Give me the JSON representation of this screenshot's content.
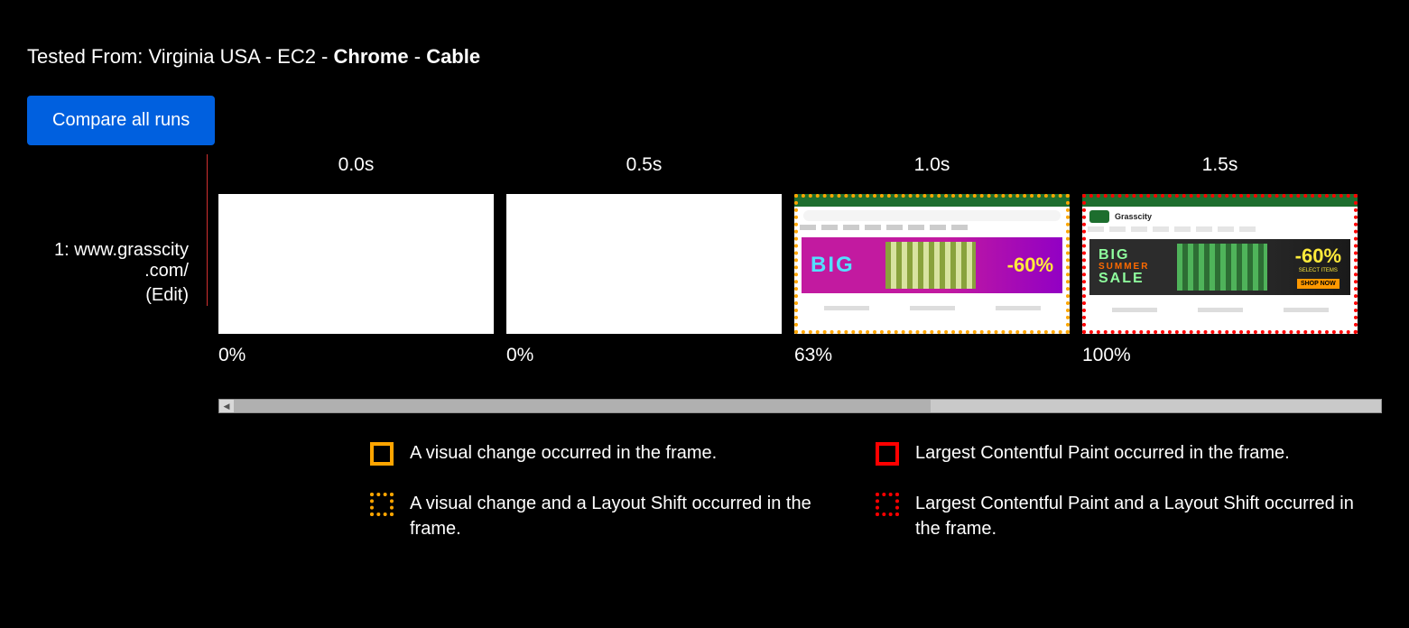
{
  "tested_from": {
    "prefix": "Tested From: ",
    "location": "Virginia USA - EC2",
    "browser": "Chrome",
    "connection": "Cable",
    "separator": " - "
  },
  "compare_button": "Compare all runs",
  "row": {
    "index": "1: ",
    "site_line1": "www.grasscity",
    "site_line2": ".com/",
    "edit": "(Edit)"
  },
  "frames": [
    {
      "time": "0.0s",
      "percent": "0%",
      "kind": "blank",
      "border": "none"
    },
    {
      "time": "0.5s",
      "percent": "0%",
      "kind": "blank",
      "border": "none"
    },
    {
      "time": "1.0s",
      "percent": "63%",
      "kind": "site_pink",
      "border": "orange-dotted"
    },
    {
      "time": "1.5s",
      "percent": "100%",
      "kind": "site_dark",
      "border": "red-dotted"
    }
  ],
  "site_mock": {
    "logo_text": "Grasscity",
    "big_text_pink": "BIG",
    "big_text_dark_line1": "BIG",
    "big_text_dark_line2": "SUMMER",
    "big_text_dark_line3": "SALE",
    "pct": "-60%",
    "select_items": "SELECT ITEMS",
    "shop_now": "SHOP NOW"
  },
  "legend": {
    "orange_solid": "A visual change occurred in the frame.",
    "red_solid": "Largest Contentful Paint occurred in the frame.",
    "orange_dotted": "A visual change and a Layout Shift occurred in the frame.",
    "red_dotted": "Largest Contentful Paint and a Layout Shift occurred in the frame."
  }
}
